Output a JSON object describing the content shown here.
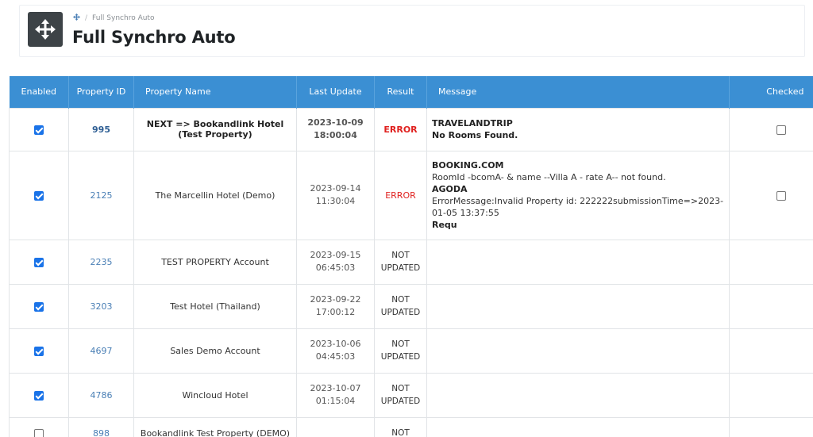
{
  "header": {
    "breadcrumb": "Full Synchro Auto",
    "title": "Full Synchro Auto",
    "icon": "move-arrows-icon"
  },
  "table": {
    "columns": [
      "Enabled",
      "Property ID",
      "Property Name",
      "Last Update",
      "Result",
      "Message",
      "Checked"
    ],
    "rows": [
      {
        "enabled": true,
        "id": "995",
        "name": "NEXT => Bookandlink Hotel (Test Property)",
        "date": "2023-10-09",
        "time": "18:00:04",
        "result": "ERROR",
        "messages": [
          "TRAVELANDTRIP",
          "No Rooms Found."
        ],
        "checked_box": true,
        "highlight": true
      },
      {
        "enabled": true,
        "id": "2125",
        "name": "The Marcellin Hotel (Demo)",
        "date": "2023-09-14",
        "time": "11:30:04",
        "result": "ERROR",
        "messages": [
          "BOOKING.COM",
          "RoomId -bcomA- & name --Villa A - rate A-- not found.",
          "AGODA",
          "ErrorMessage:Invalid Property id: 222222submissionTime=>2023-01-05 13:37:55",
          "Requ"
        ],
        "checked_box": true,
        "highlight": false
      },
      {
        "enabled": true,
        "id": "2235",
        "name": "TEST PROPERTY Account",
        "date": "2023-09-15",
        "time": "06:45:03",
        "result": "NOT UPDATED",
        "messages": [],
        "checked_box": false,
        "highlight": false
      },
      {
        "enabled": true,
        "id": "3203",
        "name": "Test Hotel (Thailand)",
        "date": "2023-09-22",
        "time": "17:00:12",
        "result": "NOT UPDATED",
        "messages": [],
        "checked_box": false,
        "highlight": false
      },
      {
        "enabled": true,
        "id": "4697",
        "name": "Sales Demo Account",
        "date": "2023-10-06",
        "time": "04:45:03",
        "result": "NOT UPDATED",
        "messages": [],
        "checked_box": false,
        "highlight": false
      },
      {
        "enabled": true,
        "id": "4786",
        "name": "Wincloud Hotel",
        "date": "2023-10-07",
        "time": "01:15:04",
        "result": "NOT UPDATED",
        "messages": [],
        "checked_box": false,
        "highlight": false
      },
      {
        "enabled": false,
        "id": "898",
        "name": "Bookandlink Test Property (DEMO)",
        "date": "",
        "time": "",
        "result": "NOT",
        "messages": [],
        "checked_box": false,
        "highlight": false
      }
    ]
  },
  "colors": {
    "header_bg": "#3b8fd3",
    "error": "#e0211f",
    "link": "#4a7fb5",
    "checkbox": "#1a73e8"
  }
}
